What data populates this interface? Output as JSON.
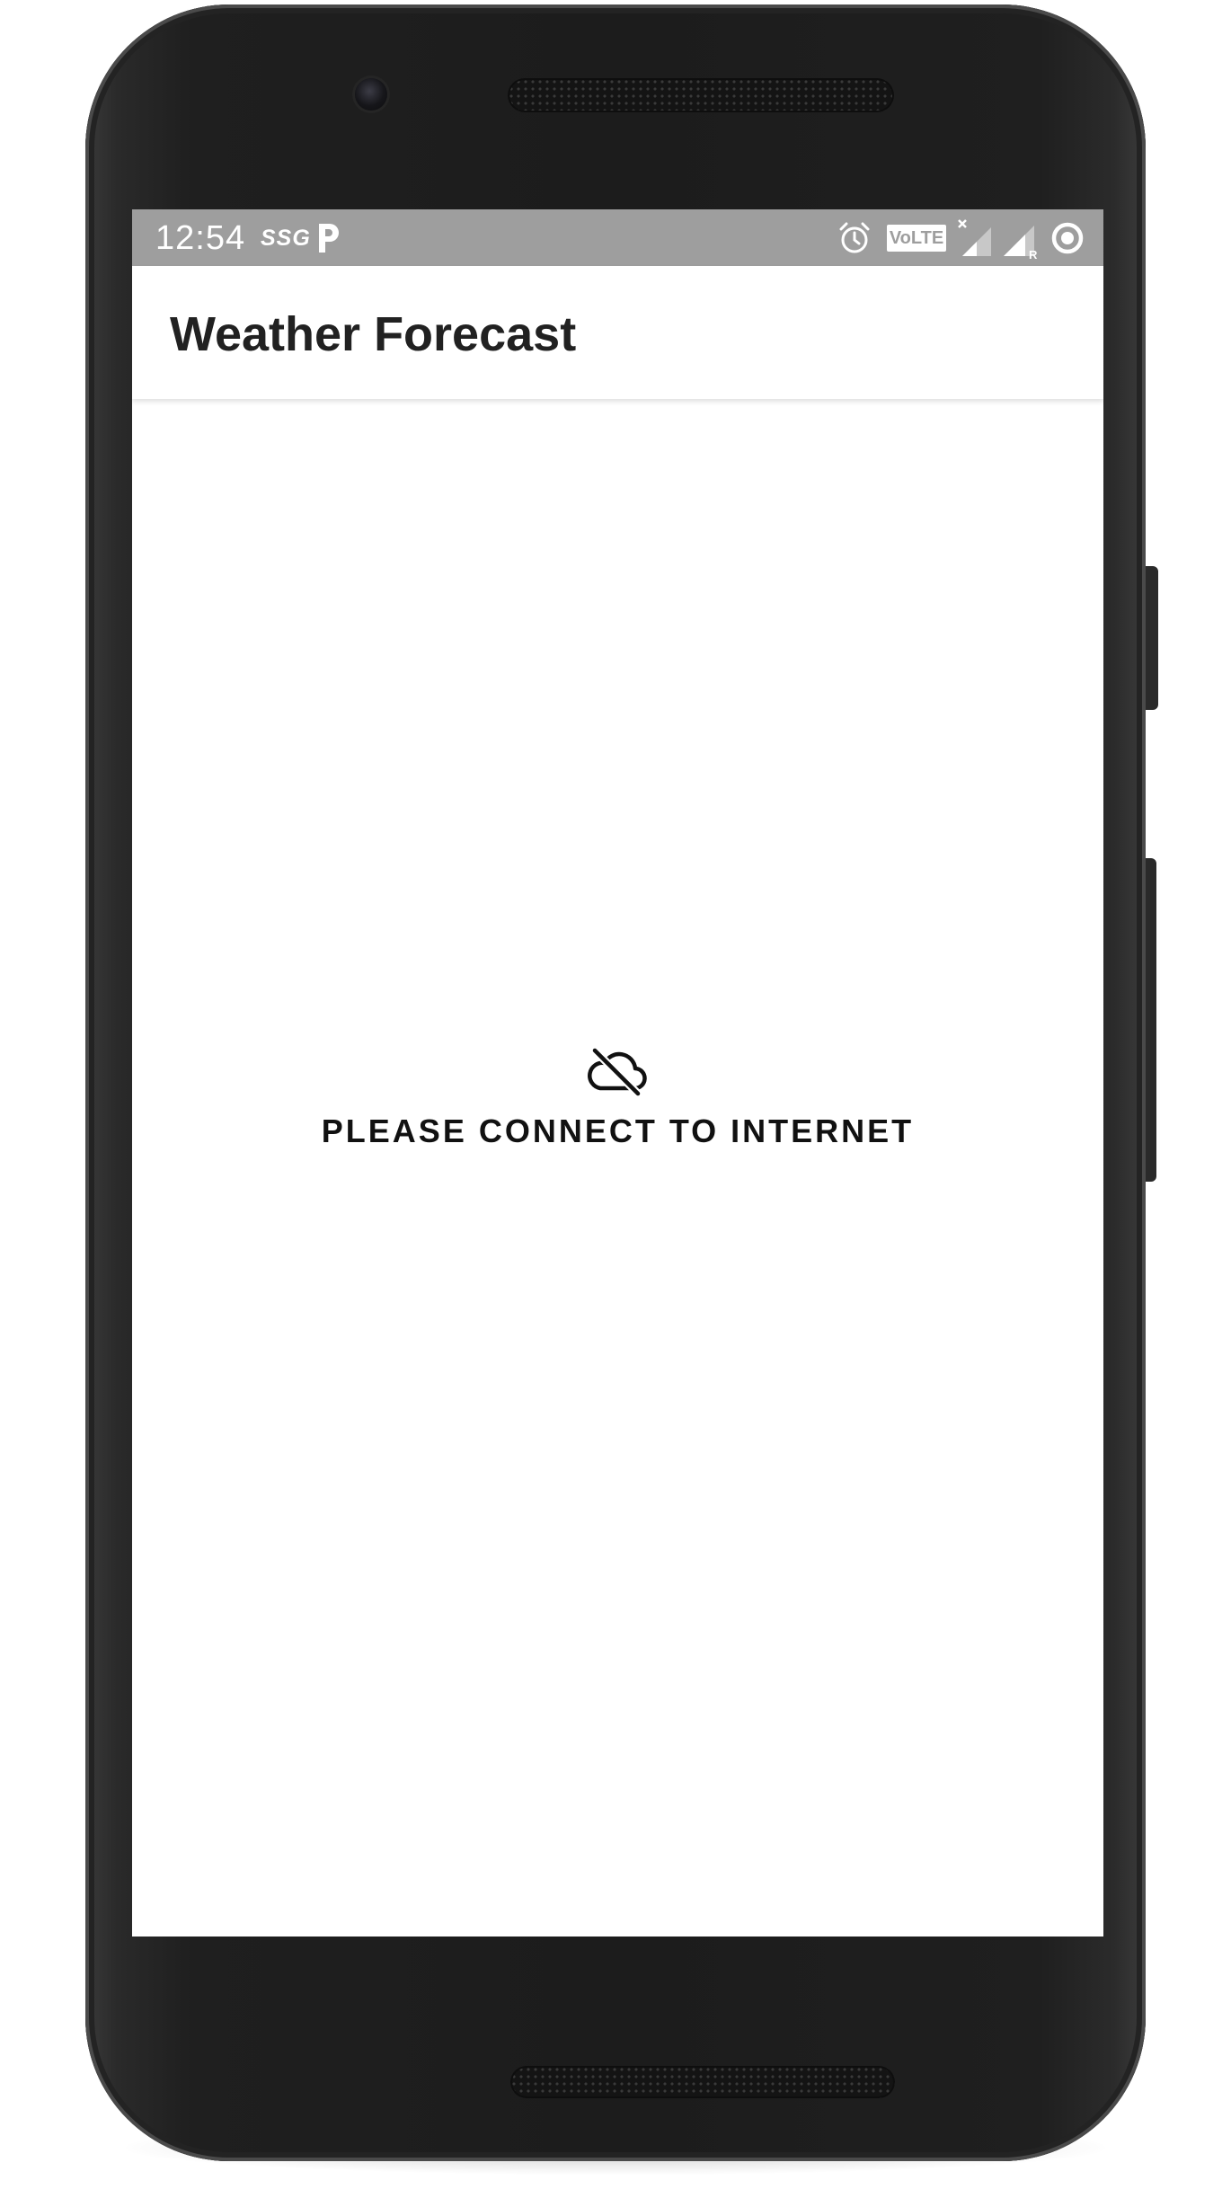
{
  "status_bar": {
    "time": "12:54",
    "carrier_badge": "SSG",
    "volte_label": "VoLTE",
    "icons": [
      "parking-icon",
      "alarm-icon",
      "volte-icon",
      "signal-x-icon",
      "signal-roaming-icon",
      "circle-status-icon"
    ],
    "background_color": "#9e9e9e"
  },
  "app_bar": {
    "title": "Weather Forecast"
  },
  "empty_state": {
    "icon": "cloud-off-icon",
    "message": "PLEASE CONNECT TO INTERNET"
  },
  "colors": {
    "device_body": "#1c1c1c",
    "screen_background": "#ffffff",
    "title_text": "#212121"
  }
}
